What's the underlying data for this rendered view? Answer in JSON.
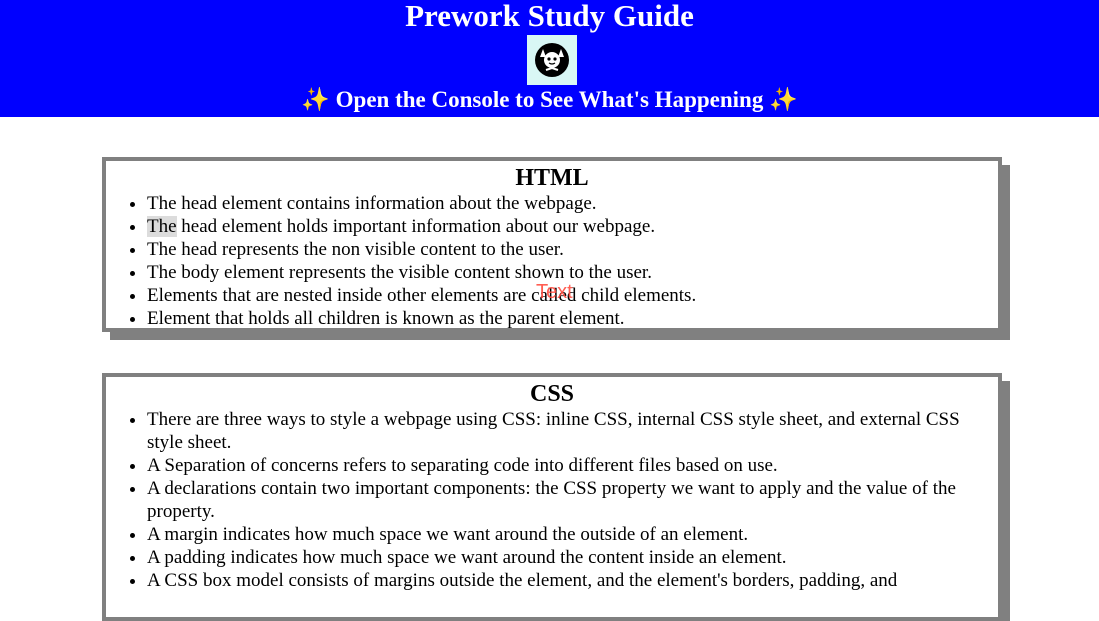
{
  "header": {
    "title": "Prework Study Guide",
    "avatar_icon": "cat-avatar-icon",
    "subtitle_sparkle_left": "✨",
    "subtitle": "Open the Console to See What's Happening",
    "subtitle_sparkle_right": "✨",
    "background_color": "#0000ff"
  },
  "sections": {
    "html": {
      "title": "HTML",
      "items": [
        "The head element contains information about the webpage.",
        "The",
        " head element holds important information about our webpage.",
        "The head represents the non visible content to the user.",
        "The body element represents the visible content shown to the user.",
        "Elements that are nested inside other elements are called child elements.",
        "Element that holds all children is known as the parent element."
      ]
    },
    "css": {
      "title": "CSS",
      "items": [
        "There are three ways to style a webpage using CSS: inline CSS, internal CSS style sheet, and external CSS style sheet.",
        "A Separation of concerns refers to separating code into different files based on use.",
        "A declarations contain two important components: the CSS property we want to apply and the value of the property.",
        "A margin indicates how much space we want around the outside of an element.",
        "A padding indicates how much space we want around the content inside an element.",
        "A CSS box model consists of margins outside the element, and the element's borders, padding, and"
      ]
    }
  },
  "overlay": {
    "text": "Text",
    "color": "#ff4d40"
  }
}
